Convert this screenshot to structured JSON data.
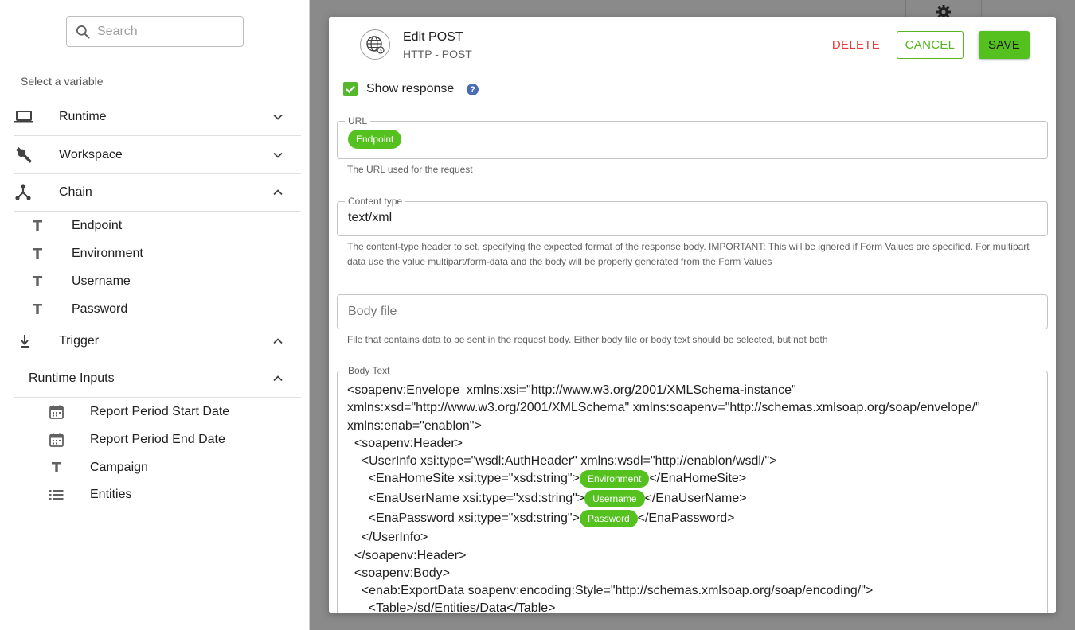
{
  "sidebar": {
    "search_placeholder": "Search",
    "select_label": "Select a variable",
    "groups": {
      "runtime": "Runtime",
      "workspace": "Workspace",
      "chain": "Chain",
      "trigger": "Trigger",
      "runtime_inputs": "Runtime Inputs"
    },
    "chain_items": [
      "Endpoint",
      "Environment",
      "Username",
      "Password"
    ],
    "runtime_input_items": [
      "Report Period Start Date",
      "Report Period End Date",
      "Campaign",
      "Entities"
    ]
  },
  "dialog": {
    "title": "Edit POST",
    "subtitle": "HTTP - POST",
    "delete_label": "DELETE",
    "cancel_label": "CANCEL",
    "save_label": "SAVE",
    "show_response_label": "Show response",
    "show_response_checked": true,
    "help_glyph": "?",
    "url": {
      "legend": "URL",
      "chip": "Endpoint",
      "helper": "The URL used for the request"
    },
    "content_type": {
      "legend": "Content type",
      "value": "text/xml",
      "helper": "The content-type header to set, specifying the expected format of the response body. IMPORTANT: This will be ignored if Form Values are specified. For multipart data use the value multipart/form-data and the body will be properly generated from the Form Values"
    },
    "body_file": {
      "placeholder": "Body file",
      "helper": "File that contains data to be sent in the request body. Either body file or body text should be selected, but not both"
    },
    "body_text": {
      "legend": "Body Text",
      "line1": "<soapenv:Envelope  xmlns:xsi=\"http://www.w3.org/2001/XMLSchema-instance\"",
      "line2": "xmlns:xsd=\"http://www.w3.org/2001/XMLSchema\" xmlns:soapenv=\"http://schemas.xmlsoap.org/soap/envelope/\"",
      "line3": "xmlns:enab=\"enablon\">",
      "line4": "  <soapenv:Header>",
      "line5": "    <UserInfo xsi:type=\"wsdl:AuthHeader\" xmlns:wsdl=\"http://enablon/wsdl/\">",
      "line6_pre": "      <EnaHomeSite xsi:type=\"xsd:string\">",
      "line6_chip": "Environment",
      "line6_post": "</EnaHomeSite>",
      "line7_pre": "      <EnaUserName xsi:type=\"xsd:string\">",
      "line7_chip": "Username",
      "line7_post": "</EnaUserName>",
      "line8_pre": "      <EnaPassword xsi:type=\"xsd:string\">",
      "line8_chip": "Password",
      "line8_post": "</EnaPassword>",
      "line9": "    </UserInfo>",
      "line10": "  </soapenv:Header>",
      "line11": "  <soapenv:Body>",
      "line12": "    <enab:ExportData soapenv:encoding:Style=\"http://schemas.xmlsoap.org/soap/encoding/\">",
      "line13": "      <Table>/sd/Entities/Data</Table>"
    }
  },
  "colors": {
    "accent_green": "#55c11f",
    "delete_red": "#e53935",
    "help_blue": "#4a6cb5",
    "overlay": "#8a8a8a"
  },
  "icons": {
    "search": "search-icon",
    "runtime": "laptop-icon",
    "workspace": "wrench-icon",
    "chain": "chain-icon",
    "trigger": "trigger-icon",
    "text_variable": "text-type-icon",
    "date_variable": "calendar-icon",
    "list_variable": "list-icon",
    "dialog": "globe-icon",
    "background": "gear-icon"
  }
}
